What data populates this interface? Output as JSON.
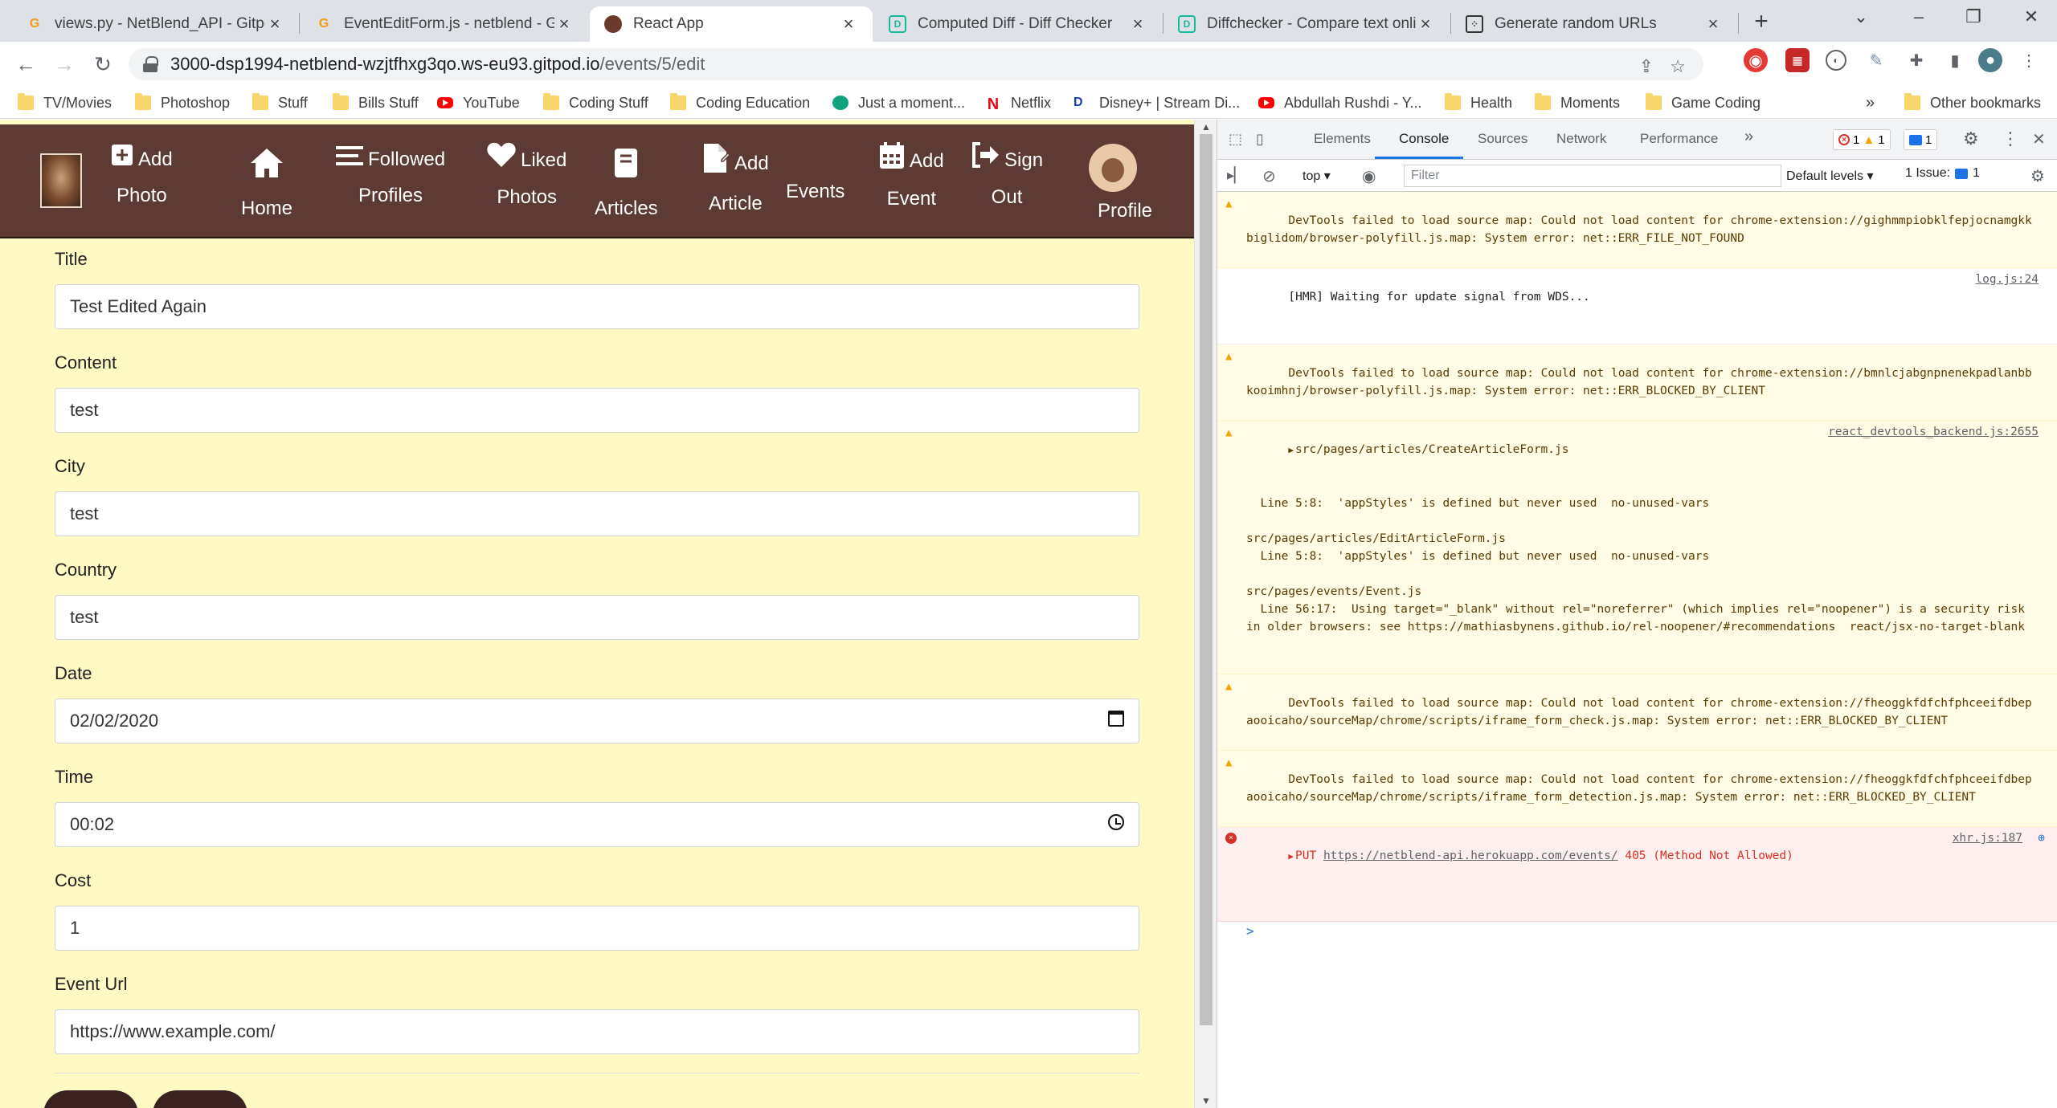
{
  "browser": {
    "tabs": [
      {
        "title": "views.py - NetBlend_API - Gitpod",
        "icon": "gitpod-icon"
      },
      {
        "title": "EventEditForm.js - netblend - Gitpod",
        "icon": "gitpod-icon"
      },
      {
        "title": "React App",
        "icon": "react-app-icon",
        "active": true
      },
      {
        "title": "Computed Diff - Diff Checker",
        "icon": "diffchecker-icon"
      },
      {
        "title": "Diffchecker - Compare text online",
        "icon": "diffchecker-icon"
      },
      {
        "title": "Generate random URLs",
        "icon": "dice-icon"
      }
    ],
    "new_tab": "+",
    "url_host": "3000-dsp1994-netblend-wzjtfhxg3qo.ws-eu93.gitpod.io",
    "url_path": "/events/5/edit",
    "bookmarks": [
      {
        "label": "TV/Movies",
        "icon": "folder-icon"
      },
      {
        "label": "Photoshop",
        "icon": "folder-icon"
      },
      {
        "label": "Stuff",
        "icon": "folder-icon"
      },
      {
        "label": "Bills Stuff",
        "icon": "folder-icon"
      },
      {
        "label": "YouTube",
        "icon": "youtube-icon"
      },
      {
        "label": "Coding Stuff",
        "icon": "folder-icon"
      },
      {
        "label": "Coding Education",
        "icon": "folder-icon"
      },
      {
        "label": "Just a moment...",
        "icon": "chatgpt-icon"
      },
      {
        "label": "Netflix",
        "icon": "netflix-icon"
      },
      {
        "label": "Disney+ | Stream Di...",
        "icon": "disney-icon"
      },
      {
        "label": "Abdullah Rushdi - Y...",
        "icon": "youtube-icon"
      },
      {
        "label": "Health",
        "icon": "folder-icon"
      },
      {
        "label": "Moments",
        "icon": "folder-icon"
      },
      {
        "label": "Game Coding",
        "icon": "folder-icon"
      }
    ],
    "more_bookmarks": "»",
    "other_bookmarks": "Other bookmarks"
  },
  "app": {
    "nav": {
      "add_photo": [
        "Add",
        "Photo"
      ],
      "home": "Home",
      "followed_profiles": [
        "Followed",
        "Profiles"
      ],
      "liked_photos": [
        "Liked",
        "Photos"
      ],
      "articles": "Articles",
      "add_article": [
        "Add",
        "Article"
      ],
      "events": "Events",
      "add_event": [
        "Add",
        "Event"
      ],
      "sign_out": [
        "Sign",
        "Out"
      ],
      "profile": "Profile"
    },
    "form": {
      "title_label": "Title",
      "title_value": "Test Edited Again",
      "content_label": "Content",
      "content_value": "test",
      "city_label": "City",
      "city_value": "test",
      "country_label": "Country",
      "country_value": "test",
      "date_label": "Date",
      "date_value": "02/02/2020",
      "time_label": "Time",
      "time_value": "00:02",
      "cost_label": "Cost",
      "cost_value": "1",
      "url_label": "Event Url",
      "url_value": "https://www.example.com/"
    }
  },
  "devtools": {
    "tabs": [
      "Elements",
      "Console",
      "Sources",
      "Network",
      "Performance"
    ],
    "more_tabs": "»",
    "error_count": "1",
    "warning_count": "1",
    "info_count": "1",
    "context": "top",
    "filter_placeholder": "Filter",
    "levels": "Default levels",
    "issues_label": "1 Issue:",
    "issues_count": "1",
    "messages": {
      "m1": "DevTools failed to load source map: Could not load content for chrome-extension://gighmmpiobklfepjocnamgkkbiglidom/browser-polyfill.js.map: System error: net::ERR_FILE_NOT_FOUND",
      "m2": "[HMR] Waiting for update signal from WDS...",
      "m2_src": "log.js:24",
      "m3": "DevTools failed to load source map: Could not load content for chrome-extension://bmnlcjabgnpnenekpadlanbbkooimhnj/browser-polyfill.js.map: System error: net::ERR_BLOCKED_BY_CLIENT",
      "m4_head": "src/pages/articles/CreateArticleForm.js",
      "m4_src": "react_devtools_backend.js:2655",
      "m4_body": "  Line 5:8:  'appStyles' is defined but never used  no-unused-vars\n\nsrc/pages/articles/EditArticleForm.js\n  Line 5:8:  'appStyles' is defined but never used  no-unused-vars\n\nsrc/pages/events/Event.js\n  Line 56:17:  Using target=\"_blank\" without rel=\"noreferrer\" (which implies rel=\"noopener\") is a security risk in older browsers: see https://mathiasbynens.github.io/rel-noopener/#recommendations  react/jsx-no-target-blank",
      "m5": "DevTools failed to load source map: Could not load content for chrome-extension://fheoggkfdfchfphceeifdbepaooicaho/sourceMap/chrome/scripts/iframe_form_check.js.map: System error: net::ERR_BLOCKED_BY_CLIENT",
      "m6": "DevTools failed to load source map: Could not load content for chrome-extension://fheoggkfdfchfphceeifdbepaooicaho/sourceMap/chrome/scripts/iframe_form_detection.js.map: System error: net::ERR_BLOCKED_BY_CLIENT",
      "m7_method": "PUT",
      "m7_url": "https://netblend-api.herokuapp.com/events/",
      "m7_status": "405 (Method Not Allowed)",
      "m7_src": "xhr.js:187"
    },
    "prompt": ">"
  }
}
